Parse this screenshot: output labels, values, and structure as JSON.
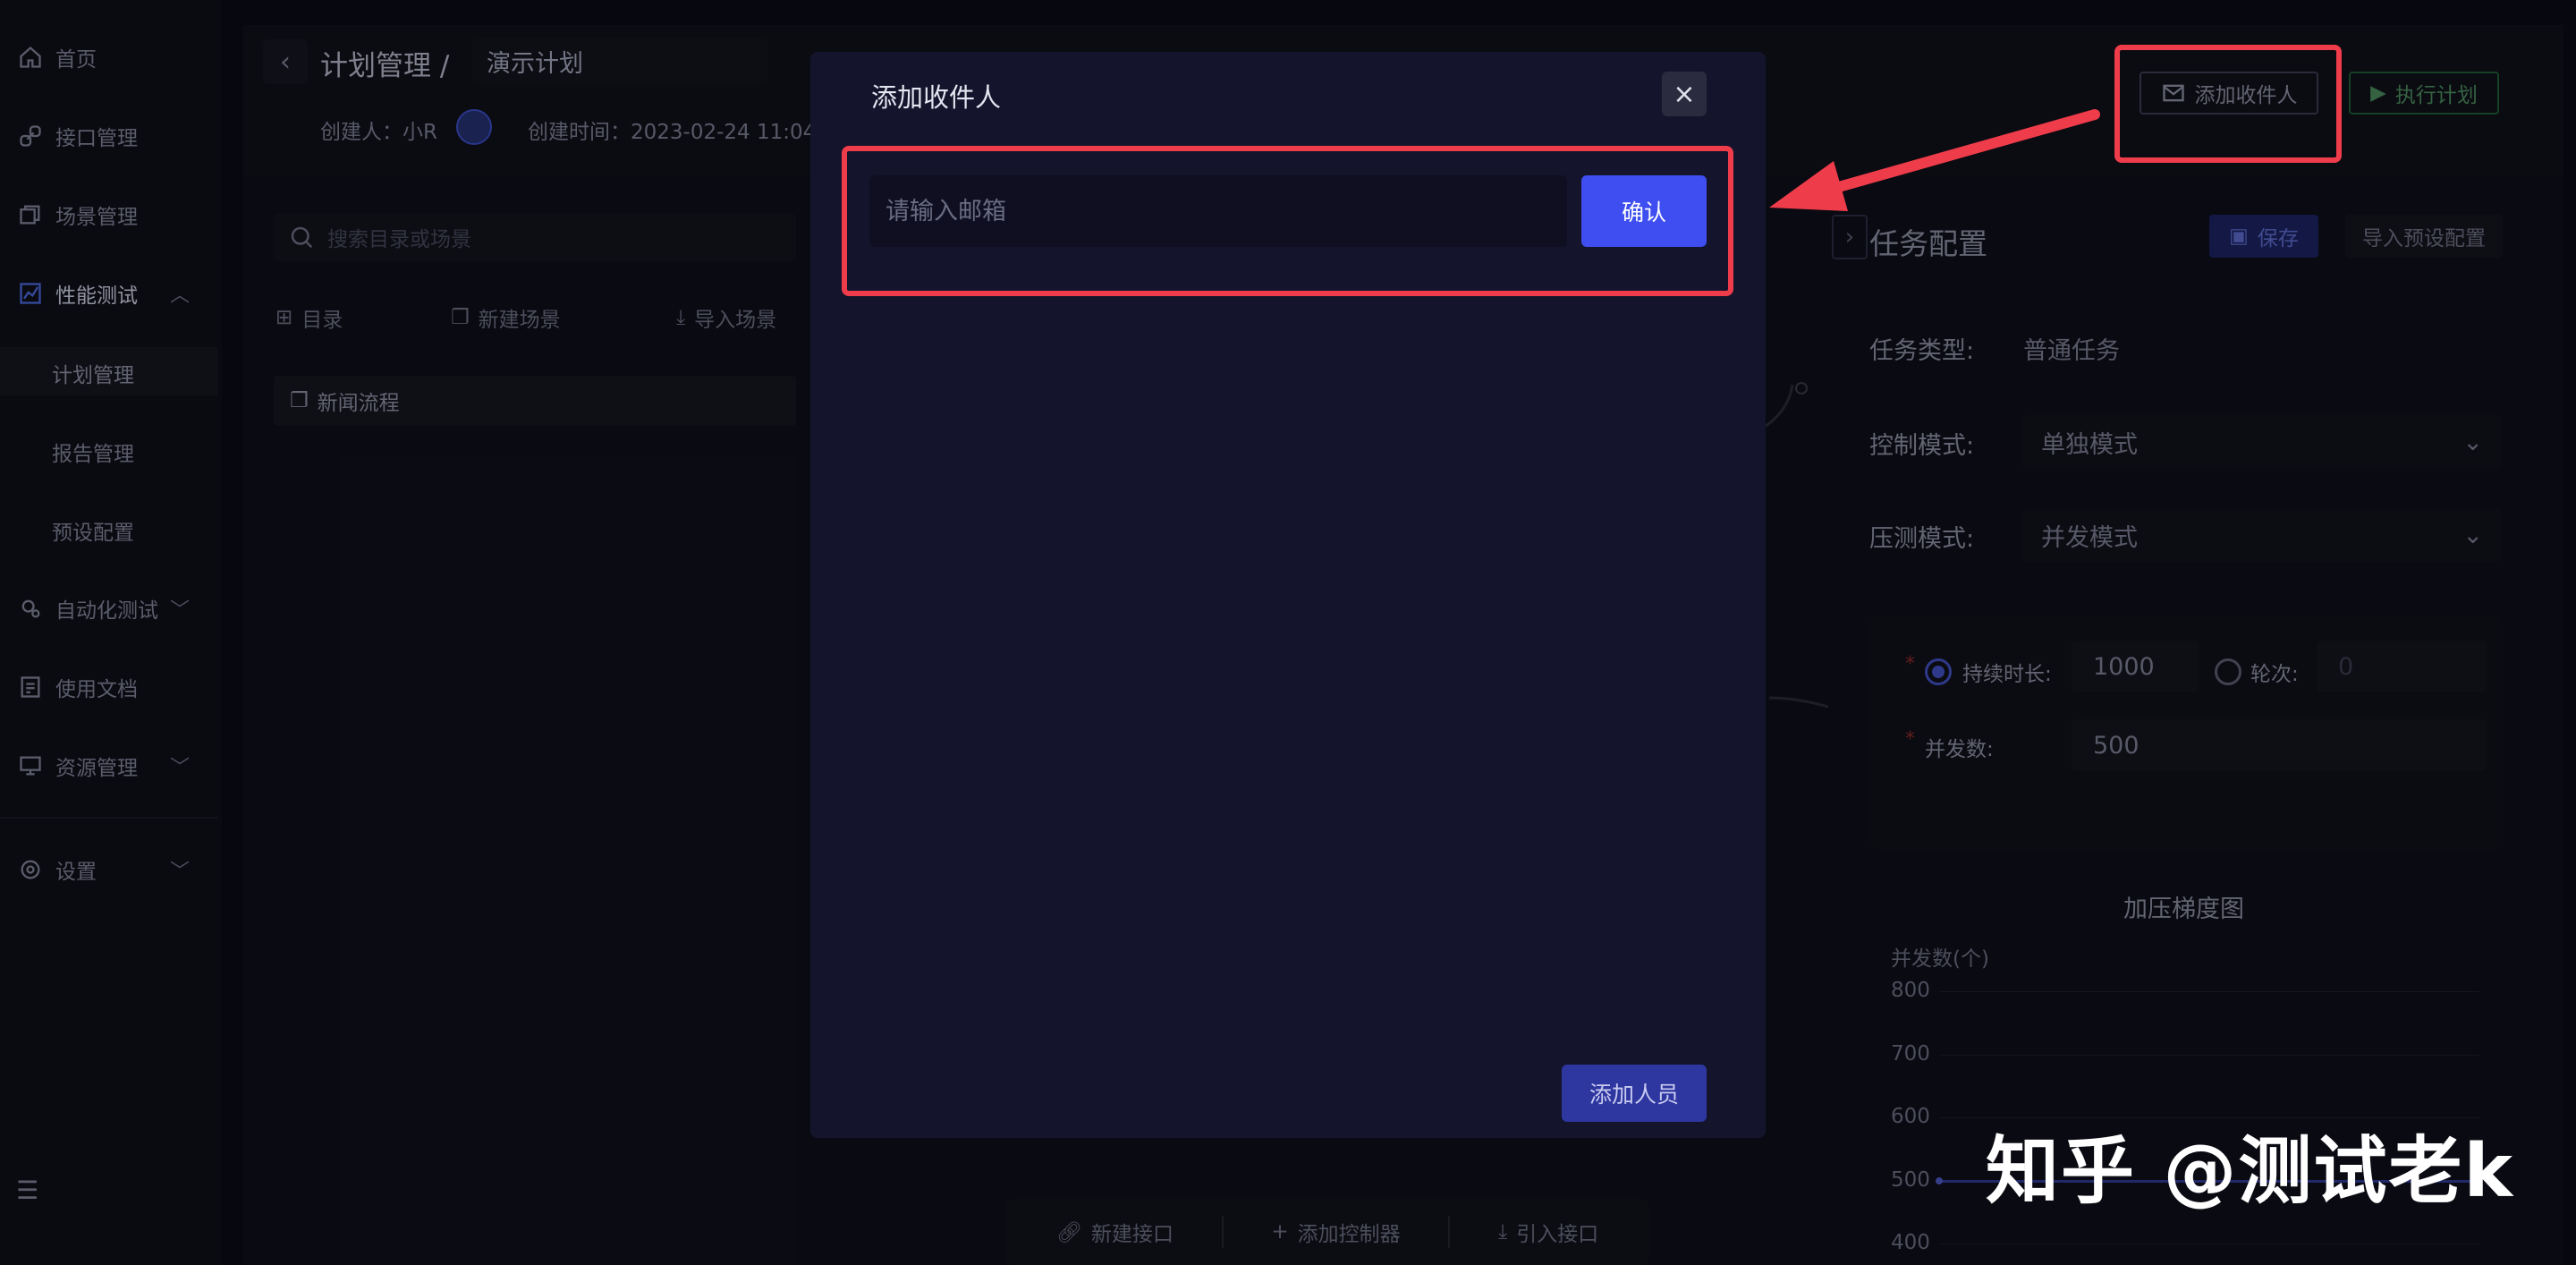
{
  "sidebar": {
    "items": [
      {
        "label": "首页",
        "icon": "home-icon"
      },
      {
        "label": "接口管理",
        "icon": "link-icon"
      },
      {
        "label": "场景管理",
        "icon": "layers-icon"
      },
      {
        "label": "性能测试",
        "icon": "chart-icon"
      },
      {
        "label": "自动化测试",
        "icon": "gear-icon"
      },
      {
        "label": "使用文档",
        "icon": "doc-icon"
      },
      {
        "label": "资源管理",
        "icon": "monitor-icon"
      },
      {
        "label": "设置",
        "icon": "settings-icon"
      }
    ],
    "sub_items": [
      "计划管理",
      "报告管理",
      "预设配置"
    ]
  },
  "header": {
    "breadcrumb": "计划管理 /",
    "plan_name": "演示计划",
    "creator_label": "创建人：",
    "creator": "小R",
    "created_label": "创建时间：",
    "created_time": "2023-02-24 11:04",
    "add_recipient": "添加收件人",
    "execute_plan": "执行计划"
  },
  "left_panel": {
    "search_placeholder": "搜索目录或场景",
    "toolbar": {
      "dir": "目录",
      "new_scene": "新建场景",
      "import_scene": "导入场景"
    },
    "tree": [
      "新闻流程"
    ]
  },
  "right_panel": {
    "title": "任务配置",
    "save": "保存",
    "import_preset": "导入预设配置",
    "task_type_label": "任务类型:",
    "task_type_value": "普通任务",
    "control_mode_label": "控制模式:",
    "control_mode_value": "单独模式",
    "stress_mode_label": "压测模式:",
    "stress_mode_value": "并发模式",
    "duration_label": "持续时长:",
    "duration_value": "1000",
    "rounds_label": "轮次:",
    "rounds_value": "0",
    "concurrency_label": "并发数:",
    "concurrency_value": "500",
    "chart_title": "加压梯度图",
    "chart_ylabel": "并发数(个)"
  },
  "chart_data": {
    "type": "line",
    "title": "加压梯度图",
    "ylabel": "并发数(个)",
    "yticks": [
      "800",
      "700",
      "600",
      "500",
      "400"
    ],
    "ylim": [
      400,
      800
    ],
    "series": [
      {
        "values": [
          500,
          500
        ]
      }
    ]
  },
  "bottom_toolbar": {
    "new_api": "新建接口",
    "add_controller": "添加控制器",
    "import_api": "引入接口"
  },
  "modal": {
    "title": "添加收件人",
    "email_placeholder": "请输入邮箱",
    "confirm": "确认",
    "add_member": "添加人员"
  },
  "watermark": "知乎 @测试老k",
  "colors": {
    "accent": "#3e4ef0",
    "highlight": "#ef3c4a",
    "modal_bg": "#14142c"
  }
}
